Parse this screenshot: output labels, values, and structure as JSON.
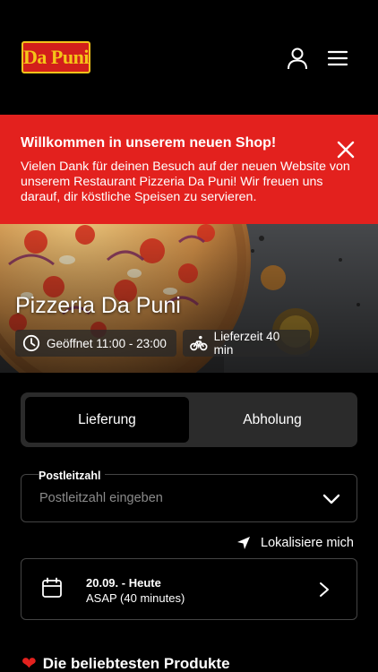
{
  "header": {
    "logo_text": "Da Puni",
    "user_icon": "user-icon",
    "menu_icon": "menu-icon"
  },
  "banner": {
    "title": "Willkommen in unserem neuen Shop!",
    "text": "Vielen Dank für deinen Besuch auf der neuen Website von unserem Restaurant Pizzeria Da Puni! Wir freuen uns darauf, dir köstliche Speisen zu servieren.",
    "close_icon": "close-icon",
    "color": "#e3211e"
  },
  "hero": {
    "title": "Pizzeria Da Puni",
    "opening_hours": "Geöffnet 11:00 - 23:00",
    "delivery_time": "Lieferzeit 40 min"
  },
  "order_mode": {
    "options": [
      "Lieferung",
      "Abholung"
    ],
    "selected": "Lieferung"
  },
  "postal_code": {
    "label": "Postleitzahl",
    "placeholder": "Postleitzahl eingeben"
  },
  "locate": {
    "label": "Lokalisiere mich"
  },
  "schedule": {
    "date": "20.09. - Heute",
    "time": "ASAP (40 minutes)"
  },
  "popular": {
    "title": "Die beliebtesten Produkte"
  }
}
